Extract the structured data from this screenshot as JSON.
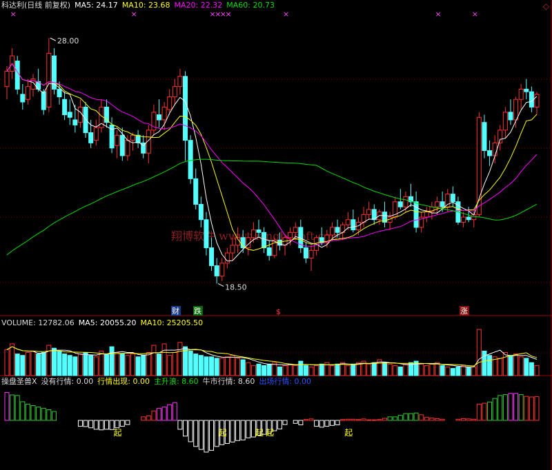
{
  "main_header": {
    "title": "科达利(日线 前复权)",
    "ma5": "MA5: 24.17",
    "ma10": "MA10: 23.68",
    "ma20": "MA20: 22.32",
    "ma60": "MA60: 20.73"
  },
  "volume_header": {
    "title": "VOLUME: 12782.06",
    "ma5": "MA5: 20055.20",
    "ma10": "MA10: 25205.50"
  },
  "indicator_header": {
    "title": "操盘圣兽X",
    "no_trend": "没有行情: 0.00",
    "trend_appear": "行情出现: 0.00",
    "main_wave": "主升浪: 8.60",
    "bull": "牛市行情: 8.60",
    "exit": "出场行情: 0.00"
  },
  "watermark": "翔博软件 www.xiangbosoft.com",
  "markers": {
    "cai": "财",
    "die": "跌",
    "s": "$",
    "zhang": "涨",
    "qi": "起"
  },
  "colors": {
    "up": "#ff3232",
    "down": "#54ffff",
    "ma5": "#ffffff",
    "ma10": "#ffff00",
    "ma20": "#ff00ff",
    "ma60": "#00e000",
    "grid": "#800000"
  },
  "chart_data": [
    {
      "type": "candlestick",
      "title": "科达利(日线 前复权)",
      "ylim": [
        17.5,
        29.0
      ],
      "annotations": [
        {
          "text": "28.00",
          "series": "high"
        },
        {
          "text": "18.50",
          "series": "low"
        }
      ],
      "series_labels": [
        "MA5",
        "MA10",
        "MA20",
        "MA60"
      ],
      "candles": [
        [
          26.1,
          26.9,
          25.6,
          26.7
        ],
        [
          26.7,
          27.6,
          26.4,
          27.3
        ],
        [
          27.1,
          27.3,
          25.8,
          26.0
        ],
        [
          25.8,
          26.2,
          25.2,
          25.5
        ],
        [
          25.6,
          26.4,
          25.4,
          26.1
        ],
        [
          26.0,
          26.6,
          25.7,
          26.4
        ],
        [
          26.3,
          26.8,
          25.9,
          26.0
        ],
        [
          25.9,
          26.0,
          25.0,
          25.2
        ],
        [
          25.3,
          28.0,
          25.1,
          27.4
        ],
        [
          27.3,
          27.6,
          25.8,
          26.0
        ],
        [
          26.0,
          26.3,
          25.4,
          25.7
        ],
        [
          25.6,
          25.9,
          24.8,
          25.0
        ],
        [
          25.1,
          25.6,
          24.6,
          24.9
        ],
        [
          24.8,
          25.4,
          24.3,
          24.6
        ],
        [
          24.7,
          25.6,
          24.5,
          25.3
        ],
        [
          25.3,
          25.5,
          24.1,
          24.3
        ],
        [
          24.3,
          24.8,
          23.7,
          23.9
        ],
        [
          24.0,
          24.8,
          23.8,
          24.5
        ],
        [
          24.5,
          25.6,
          24.3,
          25.3
        ],
        [
          25.3,
          25.6,
          24.5,
          24.7
        ],
        [
          24.6,
          24.9,
          23.5,
          23.7
        ],
        [
          23.8,
          24.4,
          23.3,
          24.2
        ],
        [
          24.2,
          24.5,
          23.2,
          23.4
        ],
        [
          23.4,
          24.2,
          23.2,
          24.0
        ],
        [
          24.0,
          24.3,
          23.6,
          24.2
        ],
        [
          24.2,
          24.4,
          23.7,
          23.9
        ],
        [
          23.9,
          24.2,
          23.3,
          23.5
        ],
        [
          23.5,
          24.6,
          23.1,
          24.4
        ],
        [
          24.4,
          25.4,
          24.2,
          25.1
        ],
        [
          25.0,
          25.6,
          24.5,
          24.8
        ],
        [
          24.8,
          25.5,
          24.4,
          25.3
        ],
        [
          25.2,
          26.0,
          25.0,
          25.7
        ],
        [
          25.7,
          26.4,
          25.4,
          26.1
        ],
        [
          26.1,
          26.8,
          25.8,
          26.5
        ],
        [
          26.5,
          26.7,
          23.2,
          24.0
        ],
        [
          24.0,
          24.2,
          22.3,
          22.5
        ],
        [
          22.5,
          22.9,
          21.3,
          21.5
        ],
        [
          21.5,
          21.8,
          20.6,
          20.9
        ],
        [
          20.9,
          21.2,
          19.5,
          19.8
        ],
        [
          19.8,
          20.2,
          18.9,
          19.1
        ],
        [
          19.1,
          19.4,
          18.4,
          18.7
        ],
        [
          18.7,
          19.4,
          18.5,
          19.2
        ],
        [
          19.2,
          19.8,
          19.0,
          19.6
        ],
        [
          19.6,
          20.2,
          19.3,
          19.9
        ],
        [
          19.9,
          20.6,
          19.6,
          20.2
        ],
        [
          20.2,
          20.5,
          19.6,
          19.8
        ],
        [
          19.8,
          20.4,
          19.5,
          20.2
        ],
        [
          20.2,
          20.8,
          20.0,
          20.5
        ],
        [
          20.5,
          20.9,
          20.2,
          20.4
        ],
        [
          20.4,
          20.6,
          19.6,
          19.8
        ],
        [
          19.8,
          20.1,
          19.3,
          19.5
        ],
        [
          19.5,
          20.2,
          19.4,
          20.1
        ],
        [
          20.1,
          20.4,
          19.7,
          19.9
        ],
        [
          19.9,
          20.3,
          19.5,
          20.2
        ],
        [
          20.2,
          20.6,
          19.9,
          20.4
        ],
        [
          20.4,
          20.8,
          20.1,
          20.6
        ],
        [
          20.6,
          20.9,
          19.6,
          19.8
        ],
        [
          19.8,
          20.0,
          19.2,
          19.4
        ],
        [
          19.4,
          19.9,
          18.9,
          19.7
        ],
        [
          19.7,
          20.3,
          19.5,
          20.2
        ],
        [
          20.2,
          20.6,
          19.9,
          20.0
        ],
        [
          20.0,
          20.5,
          19.8,
          20.3
        ],
        [
          20.3,
          20.8,
          20.1,
          20.6
        ],
        [
          20.6,
          20.9,
          20.2,
          20.4
        ],
        [
          20.4,
          20.8,
          20.1,
          20.7
        ],
        [
          20.7,
          21.2,
          20.5,
          20.9
        ],
        [
          20.9,
          21.3,
          20.4,
          20.5
        ],
        [
          20.5,
          21.0,
          20.3,
          20.8
        ],
        [
          20.8,
          21.4,
          20.6,
          21.1
        ],
        [
          21.1,
          21.6,
          20.9,
          21.3
        ],
        [
          21.3,
          21.5,
          20.7,
          20.9
        ],
        [
          20.9,
          21.3,
          20.7,
          21.2
        ],
        [
          21.2,
          21.6,
          20.6,
          20.8
        ],
        [
          20.8,
          21.2,
          20.5,
          21.0
        ],
        [
          21.0,
          21.8,
          20.9,
          21.6
        ],
        [
          21.6,
          22.1,
          21.3,
          21.4
        ],
        [
          21.4,
          22.0,
          21.2,
          21.8
        ],
        [
          21.8,
          22.3,
          21.4,
          21.6
        ],
        [
          21.6,
          22.0,
          20.4,
          20.6
        ],
        [
          20.6,
          21.2,
          20.4,
          21.0
        ],
        [
          21.0,
          21.4,
          20.8,
          21.2
        ],
        [
          21.2,
          21.6,
          20.9,
          21.4
        ],
        [
          21.4,
          21.8,
          21.1,
          21.6
        ],
        [
          21.6,
          22.0,
          21.2,
          21.4
        ],
        [
          21.4,
          22.1,
          21.2,
          21.9
        ],
        [
          21.9,
          22.2,
          21.4,
          21.6
        ],
        [
          21.6,
          21.8,
          20.7,
          20.8
        ],
        [
          20.8,
          21.2,
          20.6,
          21.0
        ],
        [
          21.0,
          21.4,
          20.8,
          20.9
        ],
        [
          20.9,
          21.2,
          20.6,
          21.1
        ],
        [
          21.1,
          25.1,
          21.0,
          24.9
        ],
        [
          24.7,
          25.0,
          23.3,
          23.6
        ],
        [
          23.6,
          24.0,
          23.0,
          23.4
        ],
        [
          23.4,
          24.2,
          23.1,
          23.9
        ],
        [
          23.9,
          24.6,
          23.6,
          24.4
        ],
        [
          24.4,
          25.3,
          24.1,
          25.1
        ],
        [
          25.1,
          25.6,
          24.6,
          24.8
        ],
        [
          24.8,
          25.7,
          24.5,
          25.6
        ],
        [
          25.6,
          26.2,
          25.2,
          26.0
        ],
        [
          26.0,
          26.4,
          25.6,
          25.9
        ],
        [
          25.9,
          26.1,
          25.1,
          25.3
        ],
        [
          25.3,
          25.9,
          25.0,
          25.8
        ]
      ],
      "volumes": [
        180,
        220,
        150,
        140,
        160,
        170,
        150,
        160,
        210,
        190,
        170,
        150,
        140,
        130,
        150,
        160,
        140,
        130,
        170,
        150,
        200,
        160,
        150,
        140,
        150,
        130,
        140,
        160,
        210,
        150,
        220,
        140,
        160,
        230,
        200,
        170,
        150,
        140,
        130,
        130,
        120,
        120,
        130,
        140,
        120,
        110,
        90,
        70,
        80,
        70,
        80,
        90,
        60,
        70,
        80,
        70,
        100,
        70,
        60,
        70,
        80,
        90,
        70,
        80,
        90,
        70,
        80,
        90,
        100,
        80,
        90,
        110,
        90,
        80,
        70,
        60,
        80,
        90,
        100,
        80,
        70,
        80,
        90,
        70,
        60,
        50,
        60,
        70,
        60,
        60,
        320,
        170,
        140,
        130,
        120,
        160,
        140,
        150,
        130,
        120,
        90,
        70
      ],
      "indicator": [
        9.4,
        8.6,
        8.4,
        6.3,
        5.5,
        5.0,
        4.5,
        4.1,
        3.6,
        3.0,
        0,
        0,
        0,
        0,
        -2.0,
        -2.1,
        -2.5,
        -3.0,
        -3.2,
        -3.0,
        -3.1,
        -2.5,
        -2.0,
        -1.4,
        0,
        0,
        1.2,
        1.5,
        3.2,
        4.1,
        4.5,
        5.3,
        6.0,
        -3.0,
        -5.3,
        -7.2,
        -8.8,
        -9.8,
        -10.7,
        -10.1,
        -8.8,
        -8.2,
        -7.8,
        -7.3,
        -6.8,
        -6.6,
        -5.9,
        -5.6,
        -5.0,
        -4.7,
        -4.4,
        -3.5,
        -2.9,
        -1.4,
        0,
        -1.0,
        -1.5,
        0.3,
        0.5,
        -2.0,
        -2.3,
        -2.0,
        -1.7,
        -1.5,
        0.3,
        0.4,
        0.4,
        0.3,
        0.5,
        0.2,
        0.2,
        0.3,
        0.7,
        1.2,
        1.2,
        1.7,
        2.3,
        2.3,
        2.5,
        1.9,
        1.0,
        0.8,
        0.6,
        0.4,
        0,
        0,
        0.4,
        0.6,
        0.5,
        0.4,
        5.5,
        5.8,
        6.2,
        7.4,
        8.4,
        8.7,
        9.1,
        9.1,
        8.7,
        8.1,
        7.9,
        8.0
      ]
    }
  ]
}
